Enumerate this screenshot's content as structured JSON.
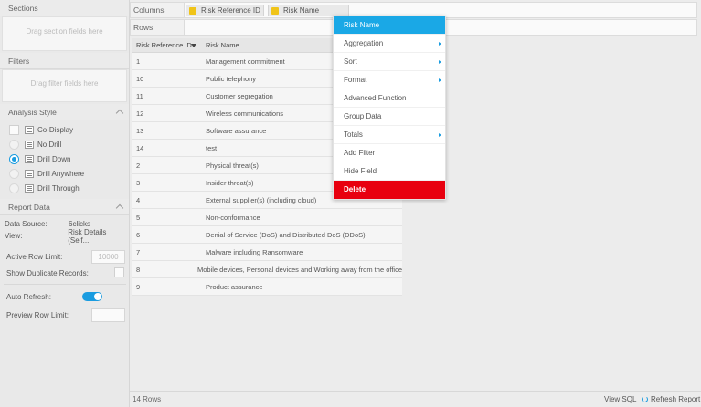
{
  "sections": {
    "title": "Sections",
    "placeholder": "Drag section fields here"
  },
  "filters": {
    "title": "Filters",
    "placeholder": "Drag filter fields here"
  },
  "analysis_style": {
    "title": "Analysis Style",
    "co_display": "Co-Display",
    "options": [
      {
        "label": "No Drill",
        "selected": false
      },
      {
        "label": "Drill Down",
        "selected": true
      },
      {
        "label": "Drill Anywhere",
        "selected": false
      },
      {
        "label": "Drill Through",
        "selected": false
      }
    ]
  },
  "report_data": {
    "title": "Report Data",
    "data_source_label": "Data Source:",
    "data_source_value": "6clicks",
    "view_label": "View:",
    "view_value": "Risk Details (Self...",
    "active_row_limit_label": "Active Row Limit:",
    "active_row_limit_value": "10000",
    "show_duplicates_label": "Show Duplicate Records:",
    "auto_refresh_label": "Auto Refresh:",
    "auto_refresh_on": true,
    "preview_row_limit_label": "Preview Row Limit:",
    "preview_row_limit_value": ""
  },
  "columns_bar": {
    "label": "Columns",
    "fields": [
      "Risk Reference ID",
      "Risk Name"
    ]
  },
  "rows_bar": {
    "label": "Rows"
  },
  "table": {
    "headers": [
      "Risk Reference ID",
      "Risk Name"
    ],
    "rows": [
      [
        "1",
        "Management commitment"
      ],
      [
        "10",
        "Public telephony"
      ],
      [
        "11",
        "Customer segregation"
      ],
      [
        "12",
        "Wireless communications"
      ],
      [
        "13",
        "Software assurance"
      ],
      [
        "14",
        "test"
      ],
      [
        "2",
        "Physical threat(s)"
      ],
      [
        "3",
        "Insider threat(s)"
      ],
      [
        "4",
        "External supplier(s) (including cloud)"
      ],
      [
        "5",
        "Non-conformance"
      ],
      [
        "6",
        "Denial of Service (DoS) and Distributed DoS (DDoS)"
      ],
      [
        "7",
        "Malware including Ransomware"
      ],
      [
        "8",
        "Mobile devices, Personal devices and Working away from the office"
      ],
      [
        "9",
        "Product assurance"
      ]
    ]
  },
  "status": {
    "row_count": "14 Rows",
    "view_sql": "View SQL",
    "refresh_report": "Refresh Report"
  },
  "context_menu": {
    "title": "Risk Name",
    "items": [
      {
        "label": "Aggregation",
        "submenu": true
      },
      {
        "label": "Sort",
        "submenu": true
      },
      {
        "label": "Format",
        "submenu": true
      },
      {
        "label": "Advanced Function",
        "submenu": false
      },
      {
        "label": "Group Data",
        "submenu": false
      },
      {
        "label": "Totals",
        "submenu": true
      },
      {
        "label": "Add Filter",
        "submenu": false
      },
      {
        "label": "Hide Field",
        "submenu": false
      }
    ],
    "delete_label": "Delete"
  },
  "colors": {
    "accent": "#1aa8e6",
    "delete": "#e8000f",
    "field_chip": "#f0c419"
  }
}
